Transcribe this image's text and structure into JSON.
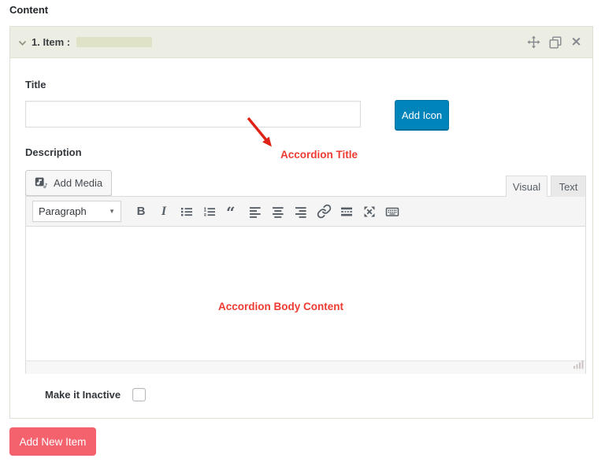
{
  "colors": {
    "accent_blue": "#0085ba",
    "accent_coral": "#f4626e",
    "annotation_red": "#ee3b31",
    "header_beige": "#ecede3",
    "highlight_beige": "#dfe2c6"
  },
  "icons": {
    "caret_down_glyph": "▼",
    "close_glyph": "×",
    "blockquote_glyph": "“",
    "bold_glyph": "B",
    "italic_glyph": "I",
    "header_action_names": [
      "move-icon",
      "duplicate-icon",
      "close-icon"
    ],
    "collapse_icon_name": "chevron-down-icon",
    "add_media_icon_name": "media-note-icon",
    "resize_grip_icon_name": "resize-grip-icon"
  },
  "page": {
    "section_label": "Content"
  },
  "panel": {
    "header": {
      "label": "1. Item :"
    },
    "title_field": {
      "label": "Title",
      "value": "",
      "placeholder": ""
    },
    "add_icon_button": "Add Icon",
    "description_field": {
      "label": "Description"
    },
    "annotations": {
      "title_note": "Accordion Title",
      "body_note": "Accordion Body Content"
    },
    "editor": {
      "add_media_label": "Add Media",
      "tabs": [
        {
          "label": "Visual",
          "active": true
        },
        {
          "label": "Text",
          "active": false
        }
      ],
      "toolbar": {
        "format_select_value": "Paragraph",
        "buttons": [
          "bold",
          "italic",
          "bulleted-list",
          "numbered-list",
          "blockquote",
          "align-left",
          "align-center",
          "align-right",
          "insert-link",
          "read-more",
          "fullscreen",
          "toolbar-toggle"
        ]
      },
      "content": ""
    },
    "inactive": {
      "label": "Make it Inactive",
      "checked": false
    }
  },
  "footer": {
    "add_new_item_button": "Add New Item"
  }
}
